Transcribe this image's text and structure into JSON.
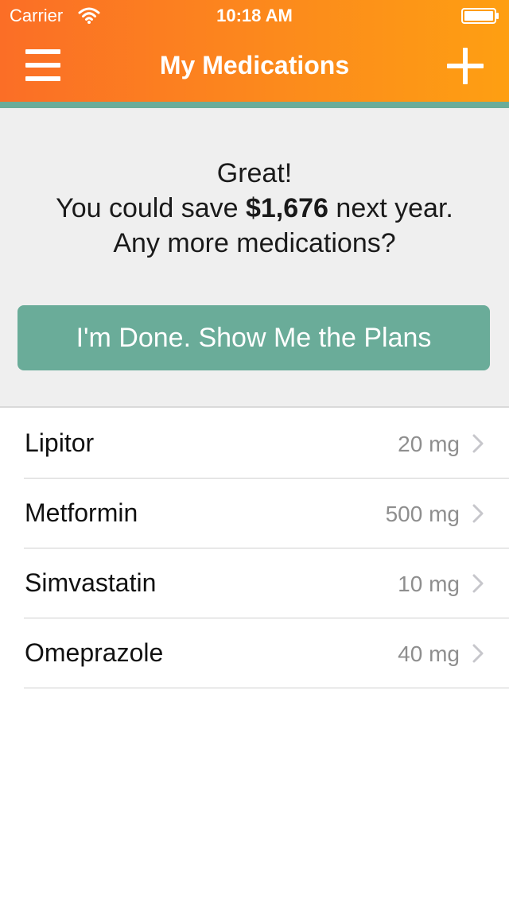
{
  "status_bar": {
    "carrier": "Carrier",
    "time": "10:18 AM"
  },
  "nav": {
    "title": "My Medications",
    "left_icon": "hamburger-menu-icon",
    "right_icon": "plus-icon"
  },
  "summary": {
    "line1": "Great!",
    "line2_prefix": "You could save ",
    "savings_amount": "$1,676",
    "line2_suffix": " next year.",
    "line3": "Any more medications?",
    "button_label": "I'm Done. Show Me the Plans"
  },
  "medications": [
    {
      "name": "Lipitor",
      "dose": "20 mg"
    },
    {
      "name": "Metformin",
      "dose": "500 mg"
    },
    {
      "name": "Simvastatin",
      "dose": "10 mg"
    },
    {
      "name": "Omeprazole",
      "dose": "40 mg"
    }
  ],
  "colors": {
    "header_gradient_start": "#fb6e26",
    "header_gradient_end": "#fe9f12",
    "accent_green": "#6aac99",
    "summary_background": "#efefef"
  }
}
